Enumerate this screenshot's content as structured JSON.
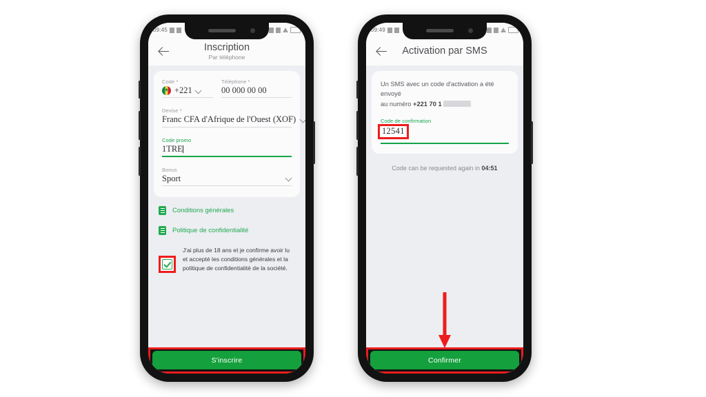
{
  "screen_left": {
    "status_bar": {
      "time": "09:45",
      "left_icons": [
        "p-icon",
        "signal-icon"
      ],
      "right_icons": [
        "wifi-icon",
        "signal-bars-icon",
        "alert-icon",
        "battery-icon"
      ]
    },
    "header": {
      "back_icon": "back-arrow-icon",
      "title": "Inscription",
      "subtitle": "Par téléphone"
    },
    "form": {
      "country_code": {
        "label": "Code *",
        "flag": "senegal-flag-icon",
        "value": "+221",
        "chevron": "chevron-down-icon"
      },
      "phone": {
        "label": "Téléphone *",
        "value": "00 000 00 00"
      },
      "currency": {
        "label": "Devise *",
        "value": "Franc CFA d'Afrique de l'Ouest (XOF)",
        "chevron": "chevron-down-icon"
      },
      "promo_code": {
        "label": "Code promo",
        "value": "1TRE",
        "focused": true
      },
      "bonus": {
        "label": "Bonus",
        "value": "Sport",
        "chevron": "chevron-down-icon"
      }
    },
    "links": [
      {
        "icon": "document-icon",
        "label": "Conditions générales"
      },
      {
        "icon": "document-icon",
        "label": "Politique de confidentialité"
      }
    ],
    "consent": {
      "checked": true,
      "highlighted": true,
      "text": "J'ai plus de 18 ans et je confirme avoir lu et accepté les conditions générales et la politique de confidentialité de la société."
    },
    "cta": {
      "label": "S'inscrire",
      "highlighted": true,
      "color": "#14a03c"
    }
  },
  "screen_right": {
    "status_bar": {
      "time": "09:49",
      "left_icons": [
        "p-icon",
        "signal-icon"
      ],
      "right_icons": [
        "wifi-icon",
        "signal-bars-icon",
        "alert-icon",
        "battery-icon"
      ]
    },
    "header": {
      "back_icon": "back-arrow-icon",
      "title": "Activation par SMS"
    },
    "sms_message": {
      "line1": "Un SMS avec un code d'activation a été envoyé",
      "line2_prefix": "au numéro ",
      "line2_number": "+221 70 1",
      "number_redacted": true
    },
    "confirmation_code": {
      "label": "Code de confirmation",
      "value": "12541",
      "highlighted": true
    },
    "timer": {
      "prefix": "Code can be requested again in ",
      "value": "04:51"
    },
    "annotation": {
      "type": "down-arrow",
      "color": "#ee1c1c"
    },
    "cta": {
      "label": "Confirmer",
      "highlighted": true,
      "color": "#14a03c"
    }
  },
  "highlight_color": "#ee1c1c"
}
